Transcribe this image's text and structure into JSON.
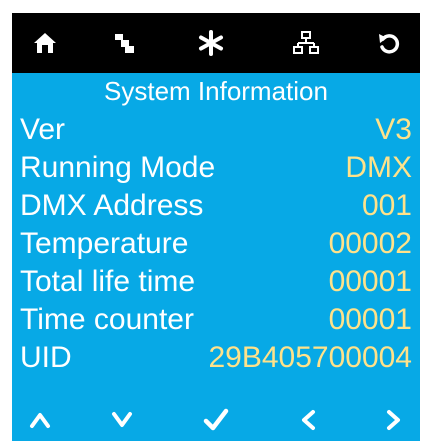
{
  "toolbar": {
    "icons": [
      "home-icon",
      "menu-icon",
      "asterisk-icon",
      "network-icon",
      "back-icon"
    ]
  },
  "title": "System Information",
  "rows": [
    {
      "label": "Ver",
      "value": "V3"
    },
    {
      "label": "Running Mode",
      "value": "DMX"
    },
    {
      "label": "DMX Address",
      "value": "001"
    },
    {
      "label": "Temperature",
      "value": "00002"
    },
    {
      "label": "Total life time",
      "value": "00001"
    },
    {
      "label": "Time counter",
      "value": "00001"
    },
    {
      "label": "UID",
      "value": "29B405700004"
    }
  ],
  "bottom_buttons": [
    "up-icon",
    "down-icon",
    "confirm-icon",
    "left-icon",
    "right-icon"
  ],
  "colors": {
    "background": "#07a9e6",
    "topbar": "#000000",
    "label": "#ffffff",
    "value": "#ffe28a"
  }
}
